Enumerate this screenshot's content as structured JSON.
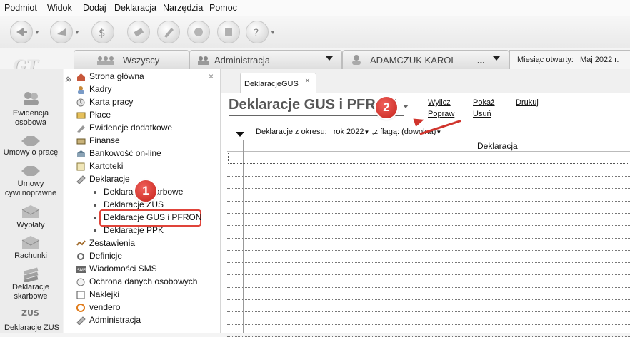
{
  "menu": [
    "Podmiot",
    "Widok",
    "Dodaj",
    "Deklaracja",
    "Narzędzia",
    "Pomoc"
  ],
  "toolbar": {
    "icons": [
      "back-arrow-icon",
      "forward-icon",
      "money-icon",
      "eraser-icon",
      "pen-icon",
      "coin-icon",
      "document-icon",
      "help-icon"
    ]
  },
  "logo": "GT",
  "selectors": {
    "group": "Wszyscy",
    "module": "Administracja",
    "user": "ADAMCZUK KAROL",
    "user_more": "...",
    "month_label": "Miesiąc otwarty:",
    "month_value": "Maj 2022 r."
  },
  "left_nav": [
    {
      "label": "Ewidencja osobowa",
      "icon": "people-icon"
    },
    {
      "label": "Umowy o pracę",
      "icon": "handshake-icon"
    },
    {
      "label": "Umowy cywilnoprawne",
      "icon": "handshake-icon"
    },
    {
      "label": "Wypłaty",
      "icon": "envelope-icon"
    },
    {
      "label": "Rachunki",
      "icon": "envelope-icon"
    },
    {
      "label": "Deklaracje skarbowe",
      "icon": "stack-icon"
    },
    {
      "label": "Deklaracje ZUS",
      "icon": "zus-icon"
    }
  ],
  "tree": {
    "items": [
      {
        "label": "Strona główna"
      },
      {
        "label": "Kadry"
      },
      {
        "label": "Karta pracy"
      },
      {
        "label": "Płace"
      },
      {
        "label": "Ewidencje dodatkowe"
      },
      {
        "label": "Finanse"
      },
      {
        "label": "Bankowość on-line"
      },
      {
        "label": "Kartoteki"
      },
      {
        "label": "Deklaracje"
      },
      {
        "label": "Deklaracje skarbowe"
      },
      {
        "label": "Deklaracje ZUS"
      },
      {
        "label": "Deklaracje GUS i PFRON"
      },
      {
        "label": "Deklaracje PPK"
      },
      {
        "label": "Zestawienia"
      },
      {
        "label": "Definicje"
      },
      {
        "label": "Wiadomości SMS"
      },
      {
        "label": "Ochrona danych osobowych"
      },
      {
        "label": "Naklejki"
      },
      {
        "label": "vendero"
      },
      {
        "label": "Administracja"
      }
    ]
  },
  "tab": {
    "label": "DeklaracjeGUS",
    "close": "×"
  },
  "page": {
    "title": "Deklaracje GUS i PFRON",
    "actions": [
      "Wylicz",
      "Popraw",
      "Pokaż",
      "Usuń",
      "Drukuj"
    ],
    "filter": {
      "prefix": "Deklaracje z okresu:",
      "period": "rok 2022",
      "flag_label": ",z flagą:",
      "flag": "(dowolna)"
    },
    "grid_header": "Deklaracja"
  },
  "markers": [
    "1",
    "2"
  ],
  "colors": {
    "accent_red": "#d0342c",
    "highlight_border": "#e0443a"
  }
}
